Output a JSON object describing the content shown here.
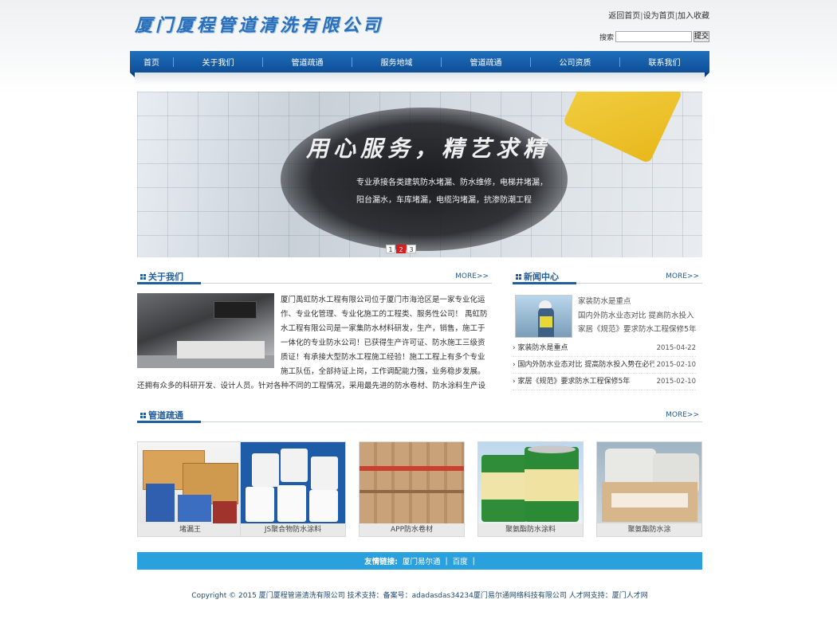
{
  "header": {
    "logo_text": "厦门厦程管道清洗有限公司",
    "toplinks": [
      "返回首页",
      "设为首页",
      "加入收藏"
    ],
    "search_label": "搜索",
    "search_value": "",
    "search_button": "提交"
  },
  "nav": {
    "items": [
      "首页",
      "关于我们",
      "管道疏通",
      "服务地域",
      "管道疏通",
      "公司资质",
      "联系我们"
    ]
  },
  "banner": {
    "headline": "用心服务，精艺求精",
    "text": "专业承接各类建筑防水堵漏、防水维修，电梯井堵漏，阳台漏水，车库堵漏，电缆沟堵漏，抗渗防潮工程",
    "slides": [
      "1",
      "2",
      "3"
    ],
    "active_slide": "2"
  },
  "about": {
    "title": "关于我们",
    "more": "MORE>>",
    "text": "厦门禹虹防水工程有限公司位于厦门市海沧区是一家专业化运作、专业化管理、专业化施工的工程类、服务性公司！     禹虹防水工程有限公司是一家集防水材料研发，生产，销售，施工于一体化的专业防水公司！已获得生产许可证、防水施工三级资质证！有承接大型防水工程施工经验！施工工程上有多个专业施工队伍，全部持证上岗，工作调配能力强，业务稳步发展。还拥有众多的科研开发、设计人员。针对各种不同的工程情况，采用最先进的防水卷材、防水涂料生产设"
  },
  "news": {
    "title": "新闻中心",
    "more": "MORE>>",
    "featured": [
      "家装防水是重点",
      "国内外防水业态对比 提高防水投入",
      "家居《规范》要求防水工程保修5年"
    ],
    "items": [
      {
        "title": "家装防水是重点",
        "date": "2015-04-22"
      },
      {
        "title": "国内外防水业态对比 提高防水投入势在必行",
        "date": "2015-02-10"
      },
      {
        "title": "家居《规范》要求防水工程保修5年",
        "date": "2015-02-10"
      }
    ]
  },
  "products": {
    "title": "管道疏通",
    "more": "MORE>>",
    "items": [
      {
        "name": "堵漏王"
      },
      {
        "name": "JS聚合物防水涂料"
      },
      {
        "name": "APP防水卷材"
      },
      {
        "name": "聚氨酯防水涂料"
      },
      {
        "name": "聚氨酯防水涂"
      }
    ]
  },
  "links": {
    "label": "友情链接:",
    "items": [
      "厦门易尔通",
      "百度"
    ],
    "sep": "|"
  },
  "footer": {
    "text": "Copyright © 2015 厦门厦程管道清洗有限公司 技术支持：备案号：adadasdas34234厦门易尔通网络科技有限公司 人才网支持：厦门人才网"
  },
  "colors": {
    "nav_blue": "#1466b3",
    "title_blue": "#1e5d9e",
    "links_bar": "#2aa0de",
    "active_dot": "#d81e1e"
  }
}
